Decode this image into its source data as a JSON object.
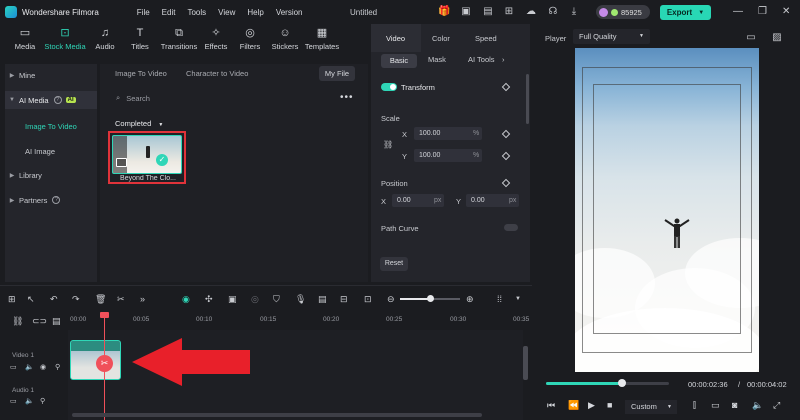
{
  "app": {
    "name": "Wondershare Filmora",
    "menus": [
      "File",
      "Edit",
      "Tools",
      "View",
      "Help",
      "Version"
    ],
    "doc_title": "Untitled",
    "credits": "85925",
    "export_label": "Export"
  },
  "media_tabs": [
    {
      "label": "Media",
      "icon": "media-icon"
    },
    {
      "label": "Stock Media",
      "icon": "stock-media-icon",
      "active": true
    },
    {
      "label": "Audio",
      "icon": "audio-icon"
    },
    {
      "label": "Titles",
      "icon": "titles-icon"
    },
    {
      "label": "Transitions",
      "icon": "transitions-icon"
    },
    {
      "label": "Effects",
      "icon": "effects-icon"
    },
    {
      "label": "Filters",
      "icon": "filters-icon"
    },
    {
      "label": "Stickers",
      "icon": "stickers-icon"
    },
    {
      "label": "Templates",
      "icon": "templates-icon"
    }
  ],
  "leftnav": {
    "mine": "Mine",
    "ai_media": "AI Media",
    "ai_badge": "AI",
    "image_to_video": "Image To Video",
    "ai_image": "AI Image",
    "library": "Library",
    "partners": "Partners"
  },
  "mediapanel": {
    "tabs": [
      "Image To Video",
      "Character to Video"
    ],
    "my_file": "My File",
    "search_placeholder": "Search",
    "section": "Completed",
    "item_name": "Beyond The Clo..."
  },
  "props": {
    "tabs": [
      "Video",
      "Color",
      "Speed"
    ],
    "subtabs": [
      "Basic",
      "Mask",
      "AI Tools"
    ],
    "transform": "Transform",
    "scale": "Scale",
    "scale_x": "100.00",
    "scale_y": "100.00",
    "pct": "%",
    "position": "Position",
    "pos_x": "0.00",
    "pos_y": "0.00",
    "px": "px",
    "x_label": "X",
    "y_label": "Y",
    "path_curve": "Path Curve",
    "reset": "Reset"
  },
  "player": {
    "label": "Player",
    "quality": "Full Quality",
    "current_time": "00:00:02:36",
    "separator": "/",
    "total_time": "00:00:04:02",
    "progress_fraction": 0.62,
    "zoom_mode": "Custom"
  },
  "timeline": {
    "ticks": [
      "00:00",
      "00:05",
      "00:10",
      "00:15",
      "00:20",
      "00:25",
      "00:30",
      "00:35"
    ],
    "track_video": "Video 1",
    "track_audio": "Audio 1"
  },
  "colors": {
    "accent": "#2fd6b7",
    "highlight_border": "#e0333a",
    "arrow": "#e8202a",
    "playhead": "#f0505a"
  }
}
